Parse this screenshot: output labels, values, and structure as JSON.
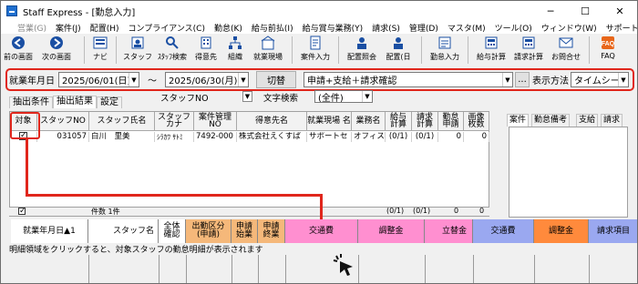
{
  "window": {
    "title": "Staff Express - [勤怠入力]",
    "min": "─",
    "max": "☐",
    "close": "✕"
  },
  "menu": [
    {
      "label": "営業(G)",
      "disabled": true
    },
    {
      "label": "案件(J)",
      "disabled": false
    },
    {
      "label": "配置(H)",
      "disabled": false
    },
    {
      "label": "コンプライアンス(C)",
      "disabled": false
    },
    {
      "label": "勤怠(K)",
      "disabled": false
    },
    {
      "label": "給与前払(I)",
      "disabled": false
    },
    {
      "label": "給与賞与業務(Y)",
      "disabled": false
    },
    {
      "label": "請求(S)",
      "disabled": false
    },
    {
      "label": "管理(D)",
      "disabled": false
    },
    {
      "label": "マスタ(M)",
      "disabled": false
    },
    {
      "label": "ツール(O)",
      "disabled": false
    },
    {
      "label": "ウィンドウ(W)",
      "disabled": false
    },
    {
      "label": "サポート(H)",
      "disabled": false
    }
  ],
  "toolbar": [
    {
      "label": "前の画面",
      "icon": "back-icon"
    },
    {
      "label": "次の画面",
      "icon": "forward-icon"
    },
    {
      "label": "ナビ",
      "icon": "navi-icon"
    },
    {
      "label": "スタッフ",
      "icon": "staff-icon"
    },
    {
      "label": "ｽﾀｯﾌ検索",
      "icon": "staff-search-icon"
    },
    {
      "label": "得意先",
      "icon": "customer-icon"
    },
    {
      "label": "組織",
      "icon": "org-icon"
    },
    {
      "label": "就業現場",
      "icon": "worksite-icon"
    },
    {
      "label": "案件入力",
      "icon": "case-input-icon"
    },
    {
      "label": "配置照会",
      "icon": "placement-inquiry-icon"
    },
    {
      "label": "配置(日",
      "icon": "placement-day-icon"
    },
    {
      "label": "勤怠入力",
      "icon": "attendance-input-icon"
    },
    {
      "label": "給与計算",
      "icon": "payroll-icon"
    },
    {
      "label": "請求計算",
      "icon": "billing-icon"
    },
    {
      "label": "お問合せ",
      "icon": "inquiry-icon"
    },
    {
      "label": "FAQ",
      "icon": "faq-icon"
    }
  ],
  "filter": {
    "date_label": "就業年月日",
    "date_from": "2025/06/01(日)",
    "tilde": "～",
    "date_to": "2025/06/30(月)",
    "switch_button": "切替",
    "condition": "申請+支給＋請求確認",
    "ellipsis": "...",
    "display_label": "表示方法",
    "display_value": "タイムシー"
  },
  "tabs": [
    "抽出条件",
    "抽出結果",
    "設定"
  ],
  "search": {
    "staff_no_label": "スタッフNO",
    "text_search_label": "文字検索",
    "text_search_value": "(全件)"
  },
  "table": {
    "headers": [
      "対象",
      "スタッフNO",
      "スタッフ氏名",
      "スタッフ カナ",
      "案件管理 NO",
      "得意先名",
      "就業現場 名",
      "業務名",
      "給与 計算",
      "請求 計算",
      "勤怠 申請",
      "画像 枚数"
    ],
    "rows": [
      {
        "checked": true,
        "staff_no": "031057",
        "name": "白川　里美",
        "kana": "ｼﾗｶﾜ ｻﾄﾐ",
        "case_no": "7492-000",
        "customer": "株式会社えくすぱ",
        "site": "サポートセ",
        "work": "オフィス",
        "pay": "(0/1)",
        "bill": "(0/1)",
        "apply": "0",
        "images": "0"
      }
    ],
    "footer": {
      "checked": true,
      "count": "件数 1件",
      "pay": "(0/1)",
      "bill": "(0/1)",
      "apply": "0",
      "images": "0"
    }
  },
  "right_tabs": [
    "案件",
    "勤怠備考",
    "支給",
    "請求"
  ],
  "bottom_headers": [
    {
      "label": "就業年月日▲1",
      "color": "#ffffff"
    },
    {
      "label": "スタッフ名",
      "color": "#ffffff"
    },
    {
      "label": "全体 確認",
      "color": "#ffffff"
    },
    {
      "label": "出勤区分 (申請)",
      "color": "#f5b87a"
    },
    {
      "label": "申請 始業",
      "color": "#f5b87a"
    },
    {
      "label": "申請 終業",
      "color": "#f5b87a"
    },
    {
      "label": "交通費",
      "color": "#ff8fd0"
    },
    {
      "label": "調整金",
      "color": "#ff8fd0"
    },
    {
      "label": "立替金",
      "color": "#ff8fd0"
    },
    {
      "label": "交通費",
      "color": "#9aa8f0"
    },
    {
      "label": "調整金",
      "color": "#ff8a3c"
    },
    {
      "label": "請求項目",
      "color": "#9aa8f0"
    }
  ],
  "hint": "明細領域をクリックすると、対象スタッフの勤怠明細が表示されます"
}
